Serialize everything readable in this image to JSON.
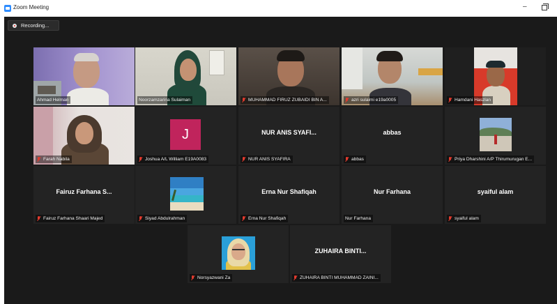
{
  "window": {
    "title": "Zoom Meeting"
  },
  "recording": {
    "label": "Recording..."
  },
  "tiles": [
    {
      "name_label": "Ahmad Helman",
      "muted": false,
      "center_name": ""
    },
    {
      "name_label": "Noorzamzarina Sulaiman",
      "muted": false,
      "center_name": ""
    },
    {
      "name_label": "MUHAMMAD FIRUZ ZUBAIDI BIN A...",
      "muted": true,
      "center_name": ""
    },
    {
      "name_label": "azri sulaimi e19a0005",
      "muted": true,
      "center_name": ""
    },
    {
      "name_label": "Hamdani Haszlan",
      "muted": true,
      "center_name": ""
    },
    {
      "name_label": "Farah Nabila",
      "muted": true,
      "center_name": ""
    },
    {
      "name_label": "Joshua A/L William E19A0083",
      "muted": true,
      "center_name": "",
      "initial": "J"
    },
    {
      "name_label": "NUR ANIS SYAFIRA",
      "muted": true,
      "center_name": "NUR ANIS SYAFI..."
    },
    {
      "name_label": "abbas",
      "muted": true,
      "center_name": "abbas"
    },
    {
      "name_label": "Priya Dharshini A/P Thirumurugan E...",
      "muted": true,
      "center_name": ""
    },
    {
      "name_label": "Fairuz Farhana Shaari Majed",
      "muted": true,
      "center_name": "Fairuz Farhana S..."
    },
    {
      "name_label": "Siyad Abdulrahman",
      "muted": true,
      "center_name": ""
    },
    {
      "name_label": "Erna Nur Shafiqah",
      "muted": true,
      "center_name": "Erna Nur Shafiqah"
    },
    {
      "name_label": "Nur Farhana",
      "muted": false,
      "center_name": "Nur Farhana"
    },
    {
      "name_label": "syaiful alam",
      "muted": true,
      "center_name": "syaiful alam"
    },
    {
      "name_label": "Norsyazwani Za",
      "muted": true,
      "center_name": ""
    },
    {
      "name_label": "ZUHAIRA BINTI MUHAMMAD ZAINI...",
      "muted": true,
      "center_name": "ZUHAIRA BINTI..."
    }
  ],
  "colors": {
    "active_speaker_border": "#c9e64a",
    "mute_icon": "#e23b2e",
    "stage_background": "#1a1a1a",
    "tile_background": "#232323",
    "avatar_initial_bg": "#c0245c"
  }
}
